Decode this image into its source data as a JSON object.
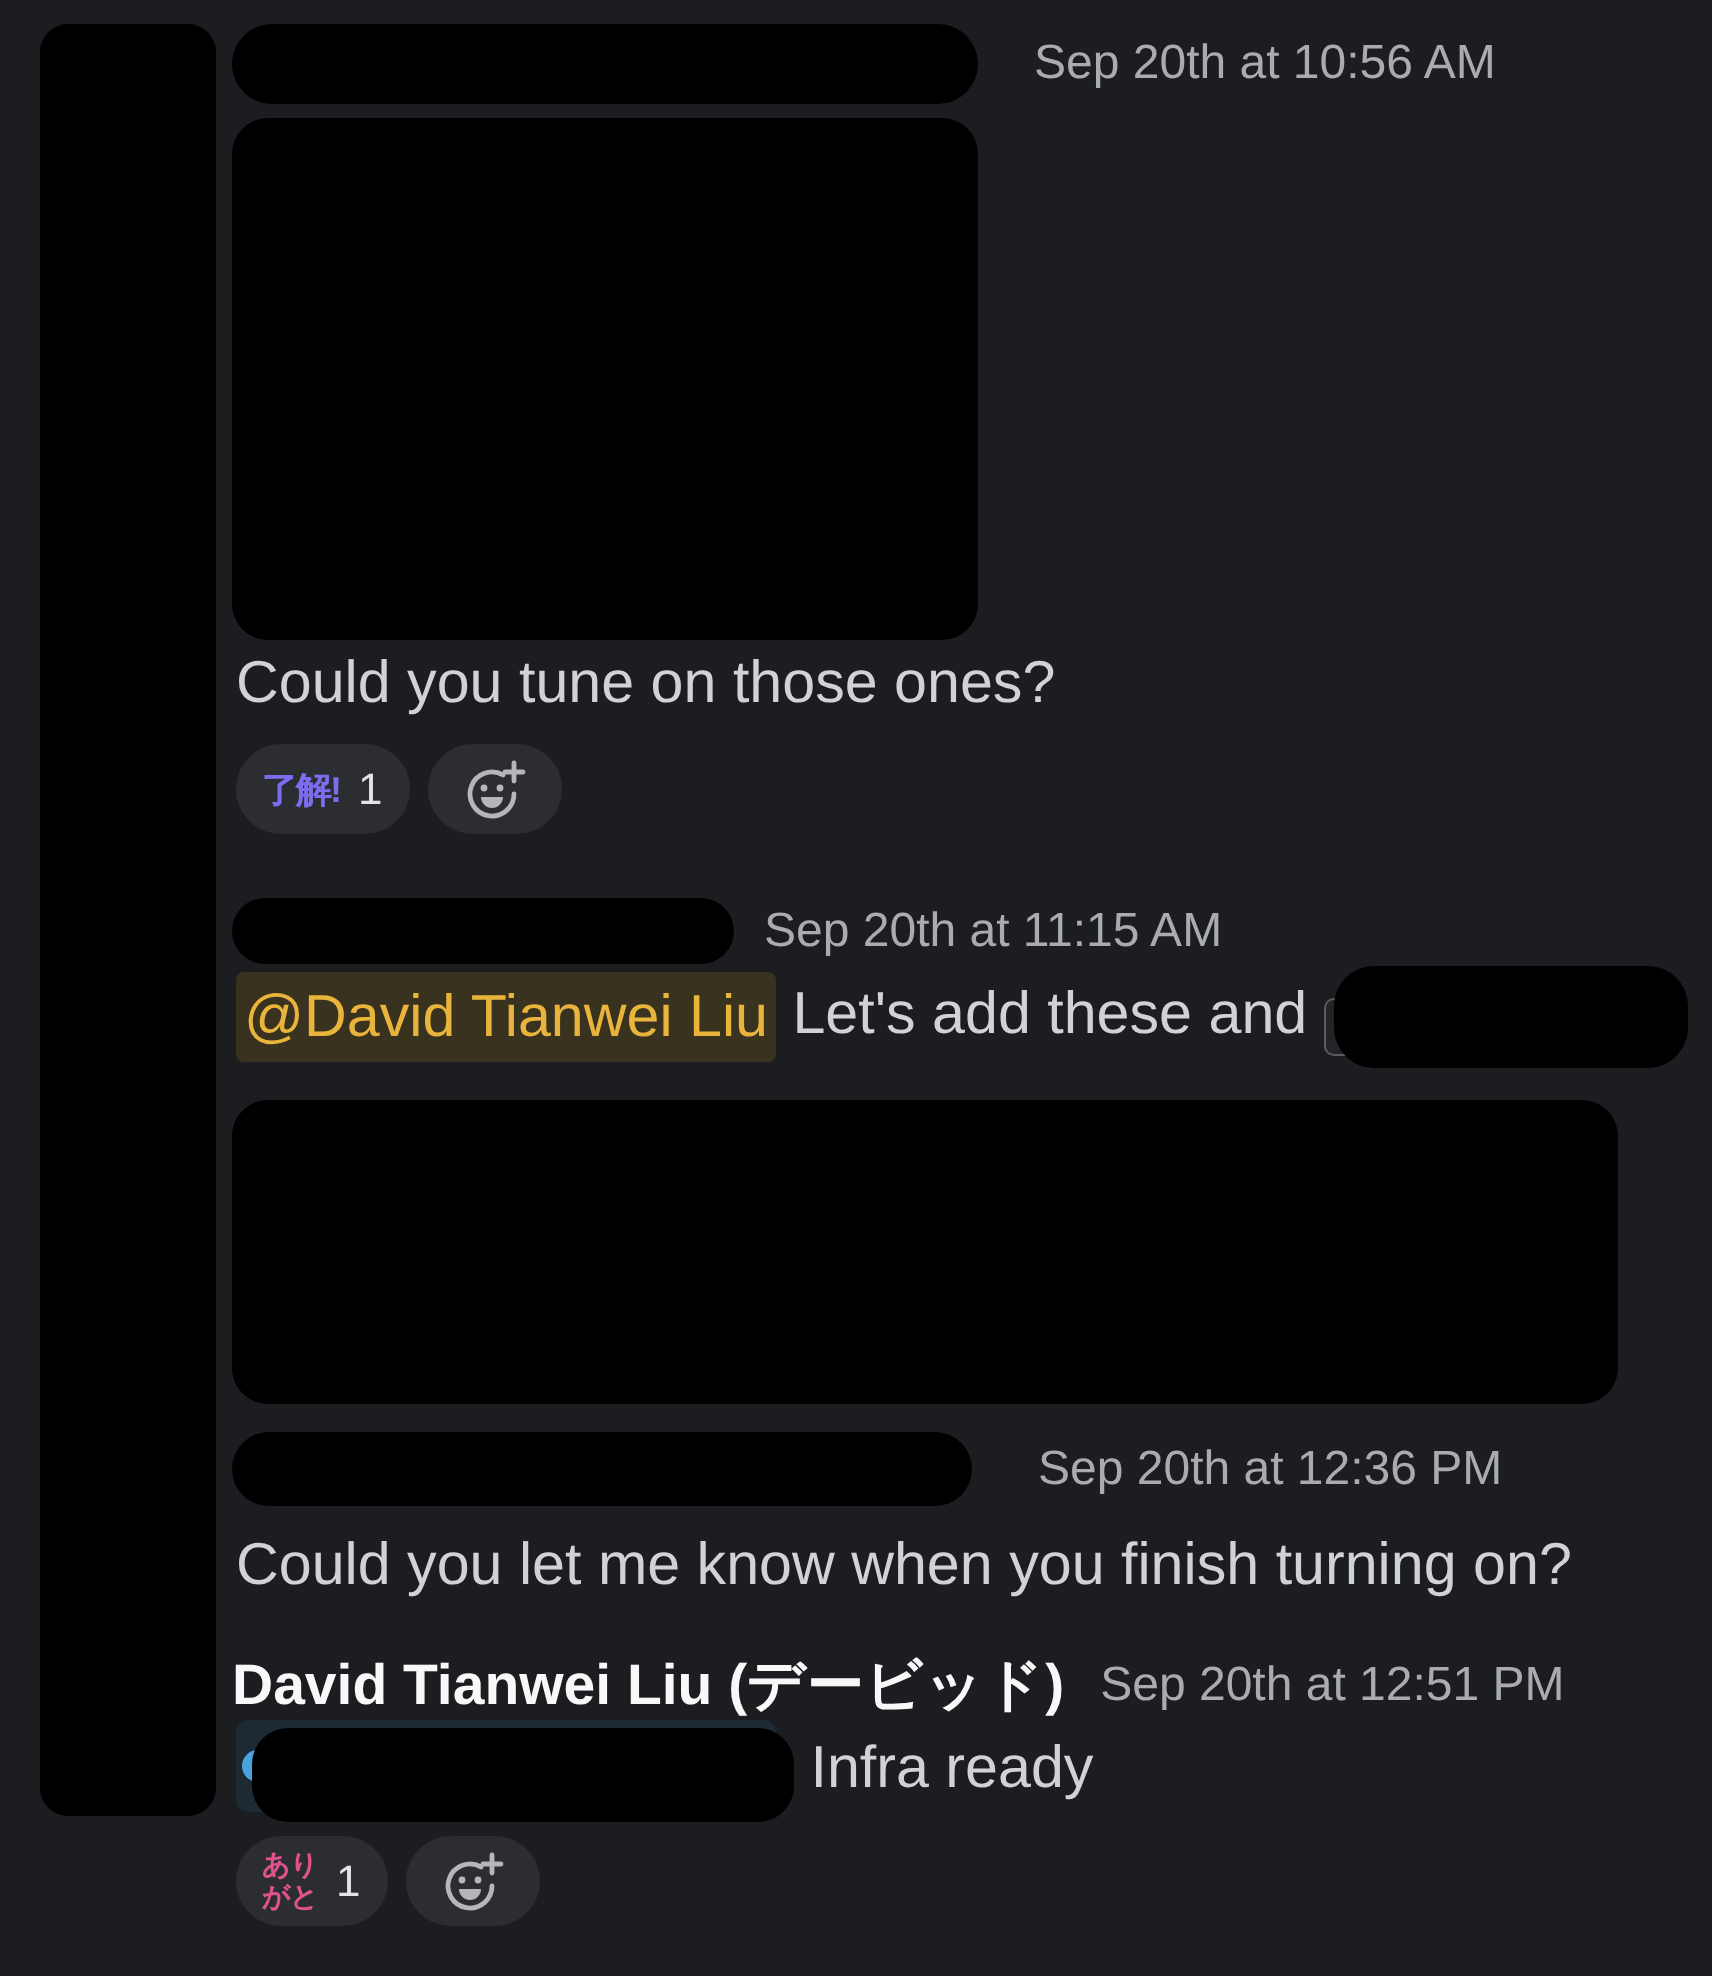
{
  "left_strip": {
    "kind": "redacted"
  },
  "messages": [
    {
      "author": {
        "kind": "redacted"
      },
      "time": "Sep 20th at 10:56 AM",
      "body": [
        {
          "kind": "redacted_block"
        },
        {
          "kind": "line",
          "parts": [
            {
              "kind": "text",
              "text": "Could you tune on those ones?"
            }
          ]
        }
      ],
      "reactions": [
        {
          "kind": "inline",
          "emoji": "了解!",
          "count": "1",
          "color": "#7c6cf0"
        }
      ],
      "add_reaction": true
    },
    {
      "author": {
        "kind": "redacted"
      },
      "time": "Sep 20th at 11:15 AM",
      "body": [
        {
          "kind": "line",
          "parts": [
            {
              "kind": "mention",
              "text": "@David Tianwei Liu"
            },
            {
              "kind": "text",
              "text": "Let's add these and"
            },
            {
              "kind": "redacted_chip"
            }
          ]
        },
        {
          "kind": "redacted_block"
        }
      ]
    },
    {
      "author": {
        "kind": "redacted"
      },
      "time": "Sep 20th at 12:36 PM",
      "body": [
        {
          "kind": "line",
          "parts": [
            {
              "kind": "text",
              "text": "Could you let me know when you finish turning on?"
            }
          ]
        }
      ]
    },
    {
      "author": {
        "kind": "name",
        "text": "David Tianwei Liu (デービッド)"
      },
      "time": "Sep 20th at 12:51 PM",
      "body": [
        {
          "kind": "line",
          "parts": [
            {
              "kind": "redacted_chip"
            },
            {
              "kind": "text",
              "text": "Infra ready"
            }
          ]
        }
      ],
      "reactions": [
        {
          "kind": "stacked",
          "emoji": "ありがと",
          "count": "1",
          "color": "#e0528c"
        }
      ],
      "add_reaction": true
    }
  ]
}
